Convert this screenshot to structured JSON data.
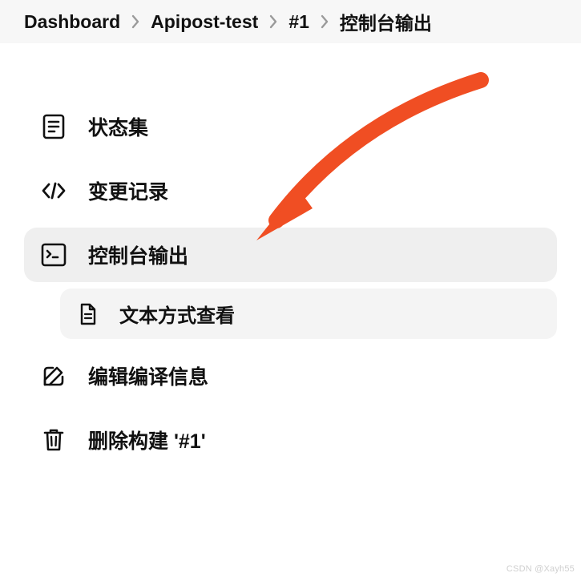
{
  "breadcrumb": {
    "items": [
      "Dashboard",
      "Apipost-test",
      "#1",
      "控制台输出"
    ]
  },
  "menu": {
    "items": [
      {
        "icon": "document-list-icon",
        "label": "状态集",
        "selected": false
      },
      {
        "icon": "code-icon",
        "label": "变更记录",
        "selected": false
      },
      {
        "icon": "terminal-icon",
        "label": "控制台输出",
        "selected": true,
        "children": [
          {
            "icon": "file-text-icon",
            "label": "文本方式查看"
          }
        ]
      },
      {
        "icon": "edit-icon",
        "label": "编辑编译信息",
        "selected": false
      },
      {
        "icon": "trash-icon",
        "label": "删除构建 '#1'",
        "selected": false
      }
    ]
  },
  "annotation": {
    "arrow_color": "#f04e23"
  },
  "watermark": "CSDN @Xayh55"
}
